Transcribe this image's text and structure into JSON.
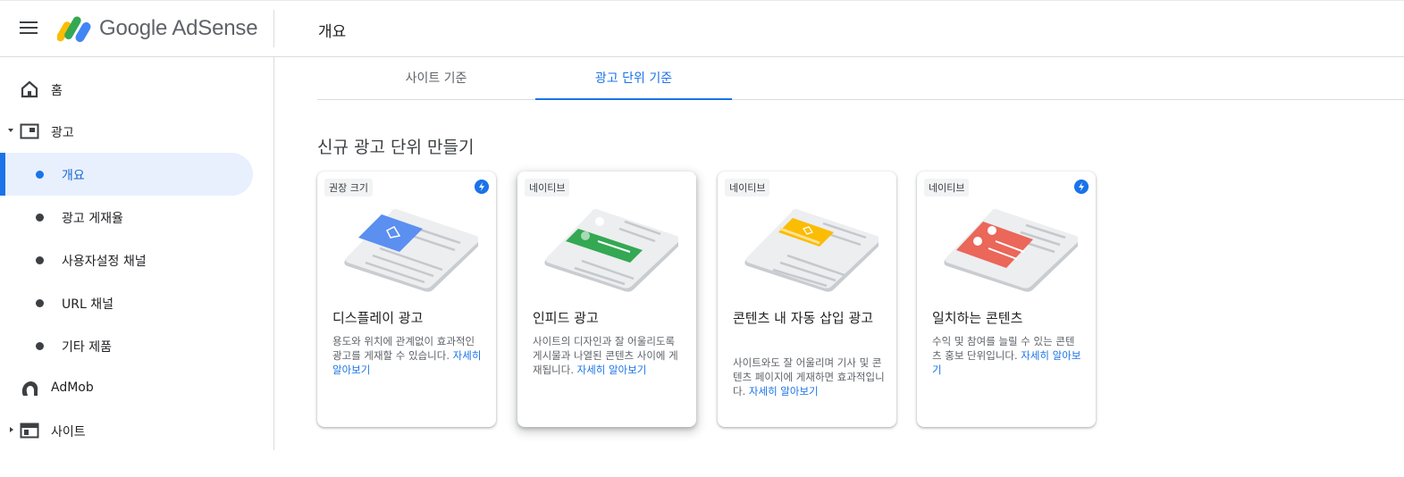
{
  "header": {
    "brand": "Google AdSense",
    "page_title": "개요"
  },
  "sidebar": {
    "items": [
      {
        "label": "홈",
        "icon": "home-icon"
      },
      {
        "label": "광고",
        "icon": "ads-icon"
      },
      {
        "label": "개요"
      },
      {
        "label": "광고 게재율"
      },
      {
        "label": "사용자설정 채널"
      },
      {
        "label": "URL 채널"
      },
      {
        "label": "기타 제품"
      },
      {
        "label": "AdMob",
        "icon": "admob-icon"
      },
      {
        "label": "사이트",
        "icon": "sites-icon"
      }
    ]
  },
  "tabs": [
    {
      "label": "사이트 기준"
    },
    {
      "label": "광고 단위 기준"
    }
  ],
  "section_title": "신규 광고 단위 만들기",
  "cards": [
    {
      "badge": "권장 크기",
      "title": "디스플레이 광고",
      "desc": "용도와 위치에 관계없이 효과적인 광고를 게재할 수 있습니다.",
      "link": "자세히 알아보기",
      "accent": "#5b8ff0"
    },
    {
      "badge": "네이티브",
      "title": "인피드 광고",
      "desc": "사이트의 디자인과 잘 어울리도록 게시물과 나열된 콘텐츠 사이에 게재됩니다.",
      "link": "자세히 알아보기",
      "accent": "#34a853"
    },
    {
      "badge": "네이티브",
      "title": "콘텐츠 내 자동 삽입 광고",
      "desc": "사이트와도 잘 어울리며 기사 및 콘텐츠 페이지에 게재하면 효과적입니다.",
      "link": "자세히 알아보기",
      "accent": "#fbbc04"
    },
    {
      "badge": "네이티브",
      "title": "일치하는 콘텐츠",
      "desc": "수익 및 참여를 늘릴 수 있는 콘텐츠 홍보 단위입니다.",
      "link": "자세히 알아보기",
      "accent": "#ea6759"
    }
  ]
}
